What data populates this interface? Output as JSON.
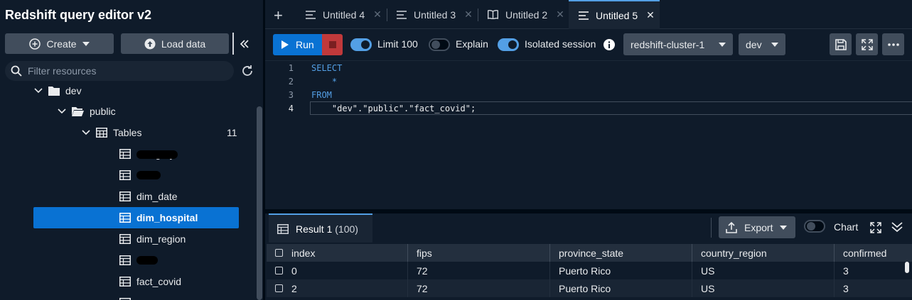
{
  "app": {
    "title": "Redshift query editor v2"
  },
  "sidebar": {
    "create_label": "Create",
    "load_label": "Load data",
    "filter_placeholder": "Filter resources",
    "tree": {
      "db": "dev",
      "schema": "public",
      "tables_label": "Tables",
      "tables_count": "11",
      "items": [
        "category",
        "",
        "dim_date",
        "dim_hospital",
        "dim_region",
        "",
        "fact_covid"
      ],
      "selected": "dim_hospital"
    }
  },
  "tabs": [
    {
      "label": "Untitled 4",
      "icon": "editor-icon"
    },
    {
      "label": "Untitled 3",
      "icon": "editor-icon"
    },
    {
      "label": "Untitled 2",
      "icon": "notebook-icon"
    },
    {
      "label": "Untitled 5",
      "icon": "editor-icon",
      "active": true
    }
  ],
  "toolbar": {
    "run_label": "Run",
    "limit_label": "Limit 100",
    "limit_on": true,
    "explain_label": "Explain",
    "explain_on": false,
    "isolated_label": "Isolated session",
    "isolated_on": true,
    "cluster": "redshift-cluster-1",
    "database": "dev"
  },
  "editor": {
    "lines": [
      {
        "num": "1",
        "text": "SELECT",
        "keyword": true
      },
      {
        "num": "2",
        "text": "    *",
        "keyword": true
      },
      {
        "num": "3",
        "text": "FROM",
        "keyword": true
      },
      {
        "num": "4",
        "text": "    \"dev\".\"public\".\"fact_covid\";",
        "keyword": false
      }
    ]
  },
  "results": {
    "tab_label": "Result 1",
    "tab_count": "(100)",
    "export_label": "Export",
    "chart_label": "Chart",
    "chart_on": false,
    "columns": [
      "index",
      "fips",
      "province_state",
      "country_region",
      "confirmed"
    ],
    "rows": [
      [
        "0",
        "72",
        "Puerto Rico",
        "US",
        "3"
      ],
      [
        "2",
        "72",
        "Puerto Rico",
        "US",
        "3"
      ]
    ]
  },
  "colors": {
    "accent": "#0972d3",
    "background": "#0f1b2a",
    "keyword": "#539fe5",
    "stop": "#c0393b"
  }
}
